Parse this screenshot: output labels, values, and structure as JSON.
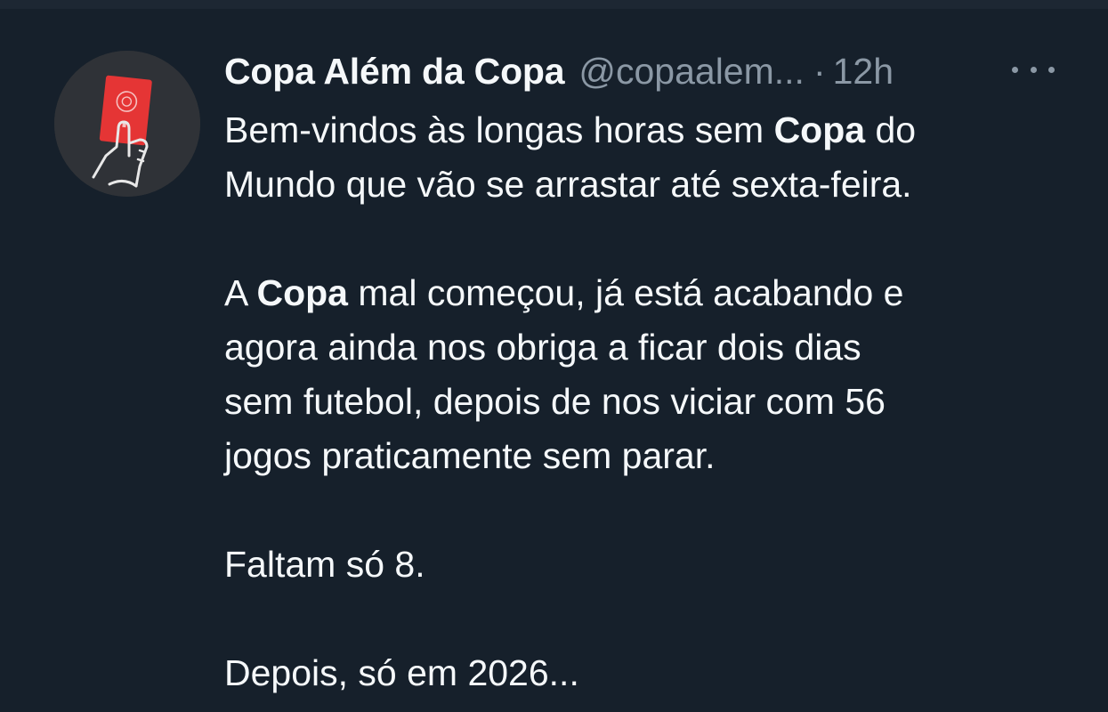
{
  "tweet": {
    "display_name": "Copa Além da Copa",
    "handle": "@copaalem...",
    "separator": "·",
    "time": "12h",
    "more_icon": "more-horizontal-icon",
    "avatar_icon": "red-card-hand-icon",
    "colors": {
      "background": "#16202b",
      "text": "#f5f8fa",
      "secondary": "#8b98a5",
      "card_red": "#e53535"
    },
    "paragraph1": {
      "line1_a": "Bem-vindos às longas horas sem ",
      "line1_b": "Copa",
      "line1_c": " do",
      "line2": "Mundo que vão se arrastar até sexta-feira."
    },
    "paragraph2": {
      "line1_a": "A ",
      "line1_b": "Copa",
      "line1_c": " mal começou, já está acabando e",
      "line2": "agora ainda nos obriga a ficar dois dias",
      "line3": "sem futebol, depois de nos viciar com 56",
      "line4": "jogos praticamente sem parar."
    },
    "paragraph3": "Faltam só 8.",
    "paragraph4": "Depois, só em 2026..."
  }
}
